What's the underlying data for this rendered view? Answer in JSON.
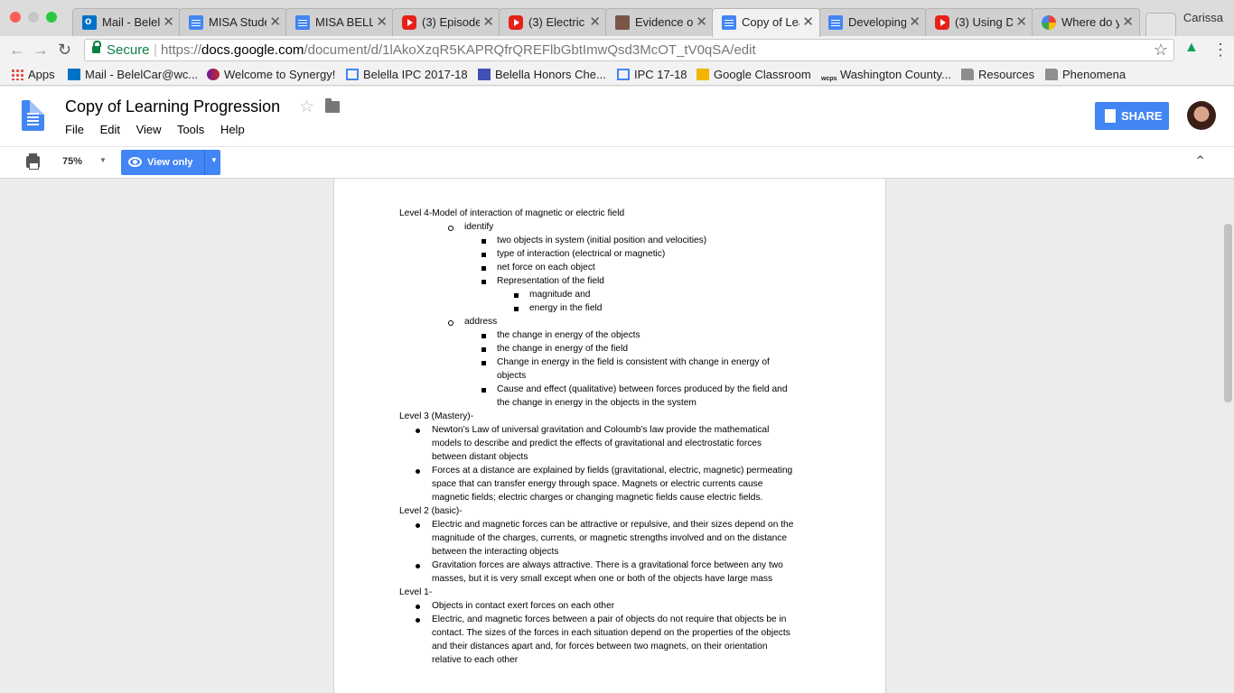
{
  "browser": {
    "tabs": [
      {
        "title": "Mail - Belel",
        "icon": "outlook-mail-icon"
      },
      {
        "title": "MISA Stude",
        "icon": "google-docs-icon"
      },
      {
        "title": "MISA BELL",
        "icon": "google-docs-icon"
      },
      {
        "title": "(3) Episode",
        "icon": "youtube-icon"
      },
      {
        "title": "(3) Electric",
        "icon": "youtube-icon"
      },
      {
        "title": "Evidence of",
        "icon": "classroom-icon"
      },
      {
        "title": "Copy of Lea",
        "icon": "google-docs-icon"
      },
      {
        "title": "Developing",
        "icon": "google-docs-icon"
      },
      {
        "title": "(3) Using D",
        "icon": "youtube-icon"
      },
      {
        "title": "Where do y",
        "icon": "google-icon"
      }
    ],
    "profile_name": "Carissa",
    "address": {
      "secure_label": "Secure",
      "scheme": "https://",
      "host": "docs.google.com",
      "path": "/document/d/1lAkoXzqR5KAPRQfrQREFlbGbtImwQsd3McOT_tV0qSA/edit"
    },
    "bookmarks": [
      "Apps",
      "Mail - BelelCar@wc...",
      "Welcome to Synergy!",
      "Belella IPC 2017-18",
      "Belella Honors Che...",
      "IPC 17-18",
      "Google Classroom",
      "Washington County...",
      "Resources",
      "Phenomena"
    ]
  },
  "docs": {
    "title": "Copy of Learning Progression",
    "menu": [
      "File",
      "Edit",
      "View",
      "Tools",
      "Help"
    ],
    "share_label": "SHARE",
    "zoom": "75%",
    "mode_label": "View only"
  },
  "document": {
    "level4_heading": "Level 4-Model of interaction of magnetic or electric field",
    "identify": "identify",
    "id_1": "two objects in system (initial position and velocities)",
    "id_2": "type of interaction (electrical or magnetic)",
    "id_3": "net force on each object",
    "id_4": "Representation of the field",
    "id_4a": "magnitude and",
    "id_4b": "energy in the field",
    "address": "address",
    "ad_1": "the change in energy of the objects",
    "ad_2": "the change in energy of the field",
    "ad_3a": "Change in energy in the field is consistent with change in energy of",
    "ad_3b": "objects",
    "ad_4a": "Cause and effect (qualitative) between forces produced by the field and",
    "ad_4b": "the change in energy in the objects in the system",
    "level3_heading": "Level 3 (Mastery)-",
    "l3_1a": "Newton’s Law of universal gravitation and Coloumb’s law provide the mathematical",
    "l3_1b": "models to describe and predict the effects of gravitational and electrostatic forces",
    "l3_1c": "between distant objects",
    "l3_2a": "Forces at a distance are explained by fields (gravitational, electric, magnetic) permeating",
    "l3_2b": "space that can transfer energy through space. Magnets or electric currents cause",
    "l3_2c": "magnetic fields; electric charges or changing magnetic fields cause electric fields.",
    "level2_heading": "Level 2 (basic)-",
    "l2_1a": "Electric and magnetic forces can be attractive or repulsive, and their sizes depend on the",
    "l2_1b": "magnitude of the charges, currents, or magnetic strengths involved and on the distance",
    "l2_1c": "between the interacting objects",
    "l2_2a": "Gravitation forces are always attractive. There is a gravitational force between any two",
    "l2_2b": "masses, but it is very small except when one or both of the objects have large mass",
    "level1_heading": "Level 1-",
    "l1_1": "Objects in contact exert forces on each other",
    "l1_2a": "Electric, and magnetic forces between a pair of objects do not require that objects be in",
    "l1_2b": "contact. The sizes of the forces in each situation depend on the properties of the objects",
    "l1_2c": "and their distances apart and, for forces between two magnets, on their orientation",
    "l1_2d": "relative to each other"
  }
}
